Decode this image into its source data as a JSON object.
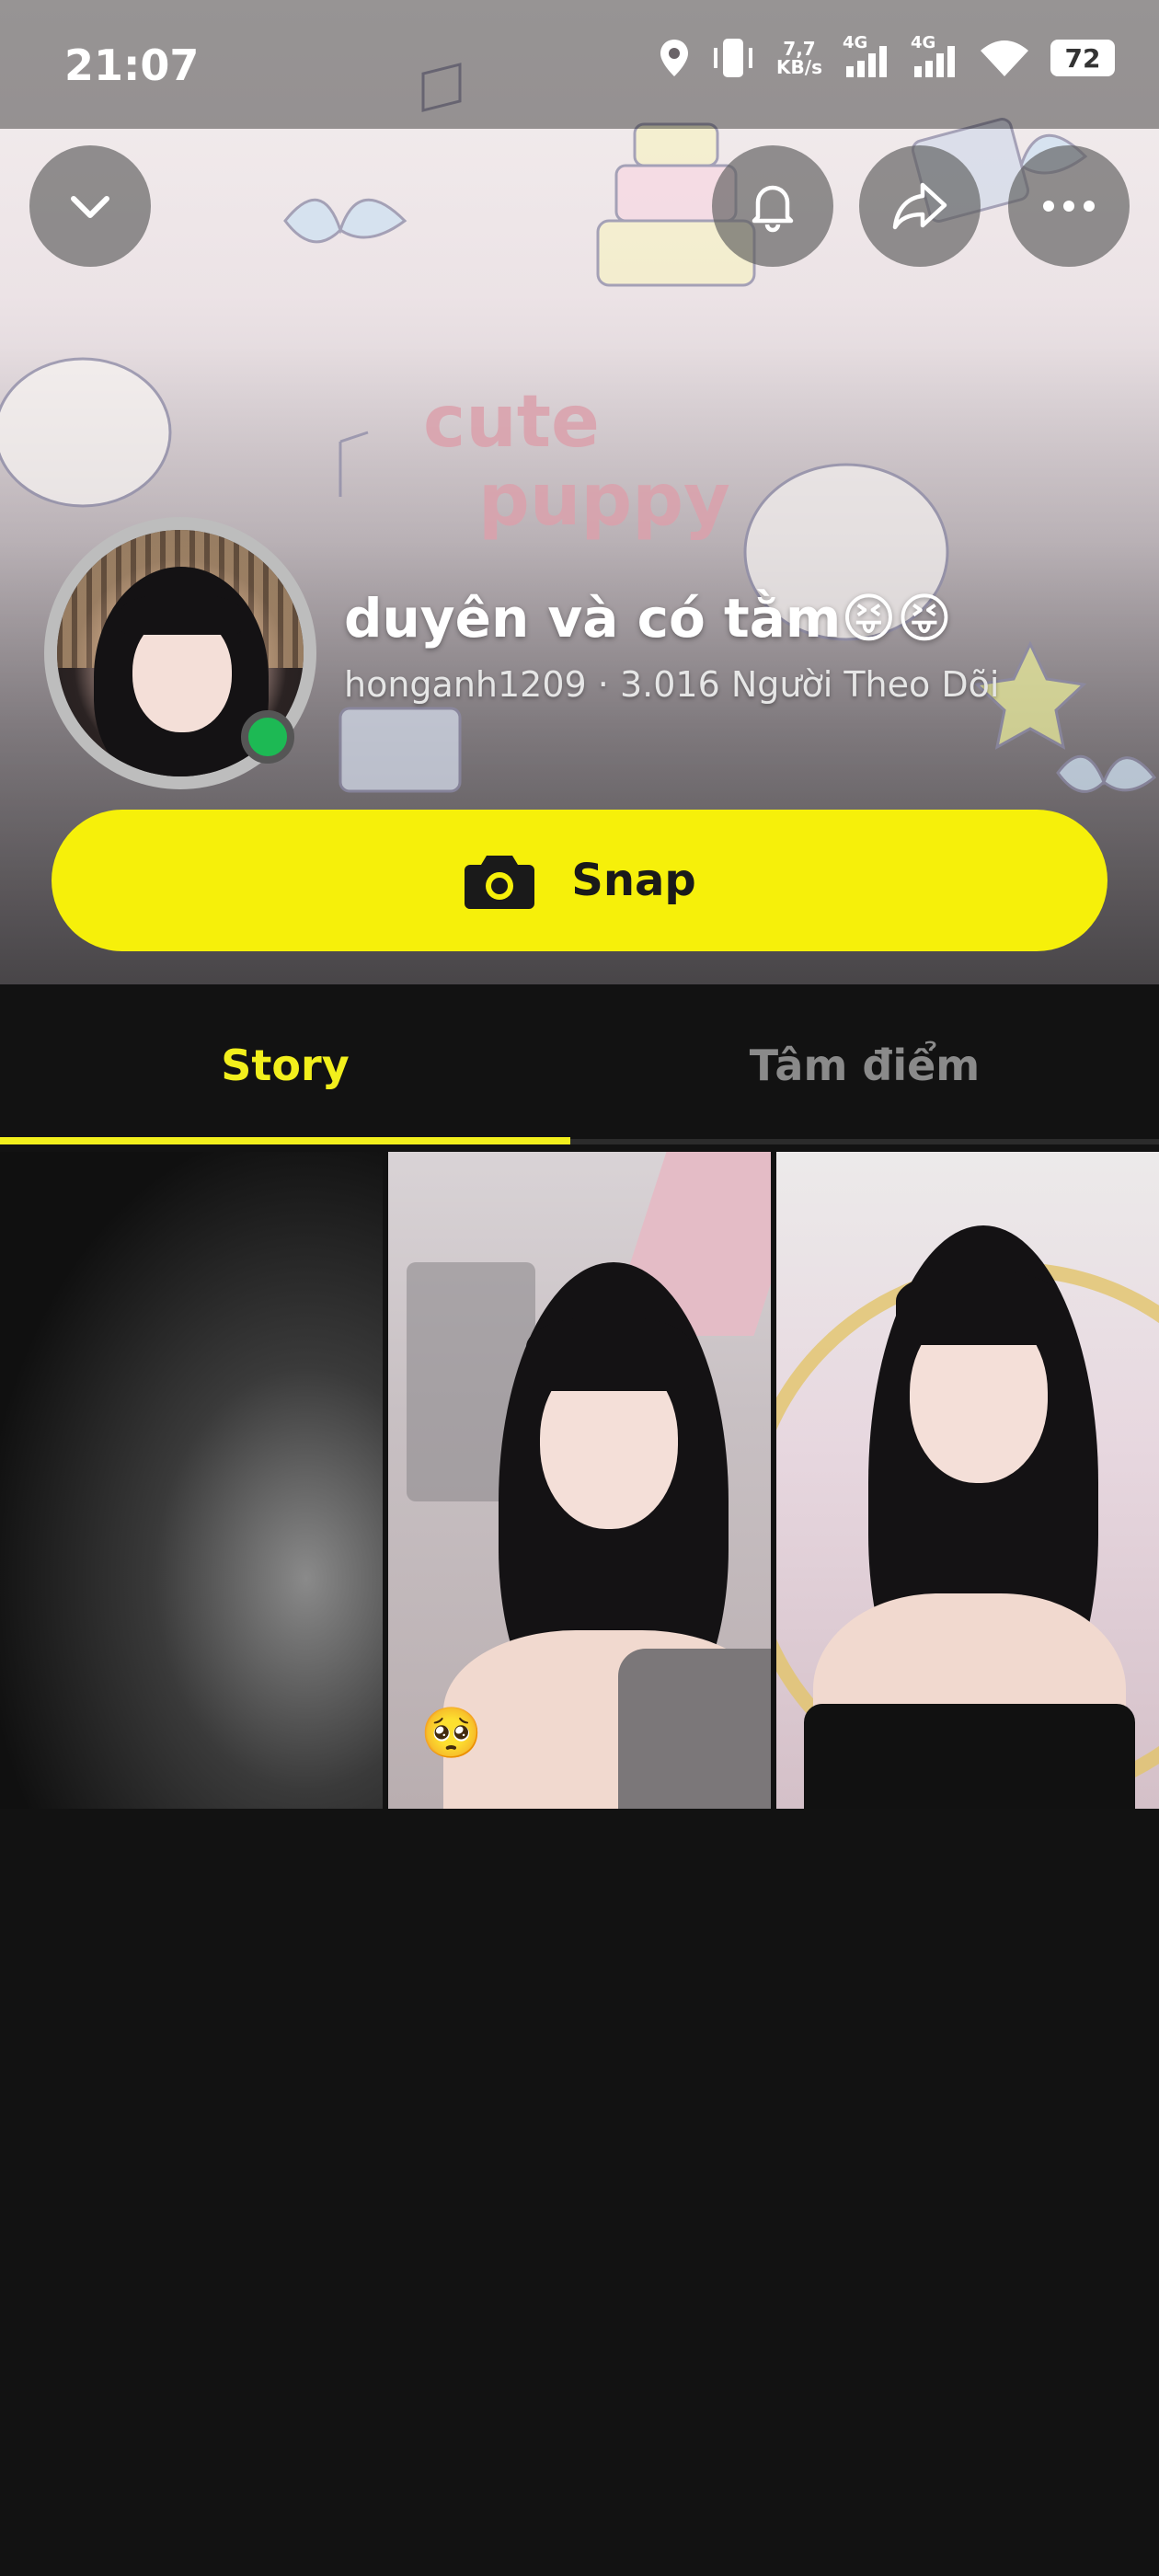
{
  "status_bar": {
    "time": "21:07",
    "net_speed_value": "7,7",
    "net_speed_unit": "KB/s",
    "signal1_label": "4G",
    "signal2_label": "4G",
    "battery": "72"
  },
  "header": {
    "background_text_line1": "cute",
    "background_text_line2": "puppy",
    "display_name": "duyên và có tằm😝😝",
    "username": "honganh1209",
    "separator": " · ",
    "followers": "3.016 Người Theo Dõi",
    "online": true
  },
  "actions": {
    "snap_label": "Snap"
  },
  "tabs": [
    {
      "label": "Story",
      "active": true
    },
    {
      "label": "Tâm điểm",
      "active": false
    }
  ],
  "stories": [
    {
      "kind": "dark-blurred"
    },
    {
      "kind": "photo",
      "emoji": "🥺"
    },
    {
      "kind": "photo"
    }
  ],
  "colors": {
    "accent_yellow": "#f6f00a",
    "tab_active": "#f2ef1c",
    "online_green": "#1db954",
    "background": "#121212"
  }
}
